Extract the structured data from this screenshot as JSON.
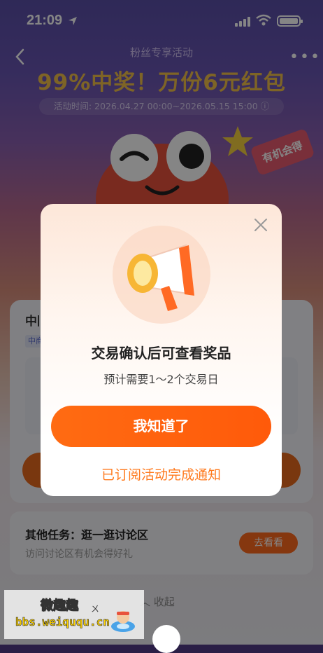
{
  "status_bar": {
    "time": "21:09"
  },
  "header": {
    "subtitle": "粉丝专享活动",
    "headline": "99%中奖！万份6元红包",
    "period": "活动时间: 2026.04.27 00:00~2026.05.15 15:00"
  },
  "hero": {
    "tag_text": "有机会得"
  },
  "card": {
    "title_partial": "中国",
    "pill_partial": "中商"
  },
  "task": {
    "title": "其他任务：逛一逛讨论区",
    "desc": "访问讨论区有机会得好礼",
    "button": "去看看"
  },
  "collapse_label": "收起",
  "modal": {
    "title": "交易确认后可查看奖品",
    "subtitle": "预计需要1～2个交易日",
    "primary_button": "我知道了",
    "secondary_link": "已订阅活动完成通知"
  },
  "watermark": {
    "name": "微趣趣",
    "url": "bbs.weiququ.cn"
  },
  "colors": {
    "accent": "#ff6b12",
    "headline": "#f2c04a"
  }
}
